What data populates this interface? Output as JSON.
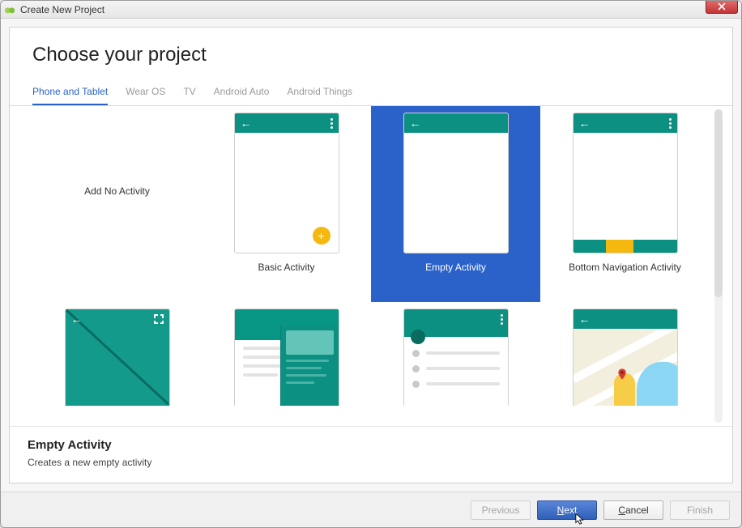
{
  "window": {
    "title": "Create New Project"
  },
  "page": {
    "heading": "Choose your project"
  },
  "tabs": [
    {
      "label": "Phone and Tablet",
      "active": true
    },
    {
      "label": "Wear OS",
      "active": false
    },
    {
      "label": "TV",
      "active": false
    },
    {
      "label": "Android Auto",
      "active": false
    },
    {
      "label": "Android Things",
      "active": false
    }
  ],
  "templates_row1": [
    {
      "label": "Add No Activity"
    },
    {
      "label": "Basic Activity"
    },
    {
      "label": "Empty Activity",
      "selected": true
    },
    {
      "label": "Bottom Navigation Activity"
    }
  ],
  "selection": {
    "title": "Empty Activity",
    "description": "Creates a new empty activity"
  },
  "buttons": {
    "previous": "Previous",
    "next": "Next",
    "cancel": "Cancel",
    "finish": "Finish"
  },
  "colors": {
    "accent": "#2b62c9",
    "teal": "#0b9081",
    "amber": "#f5b80f"
  }
}
